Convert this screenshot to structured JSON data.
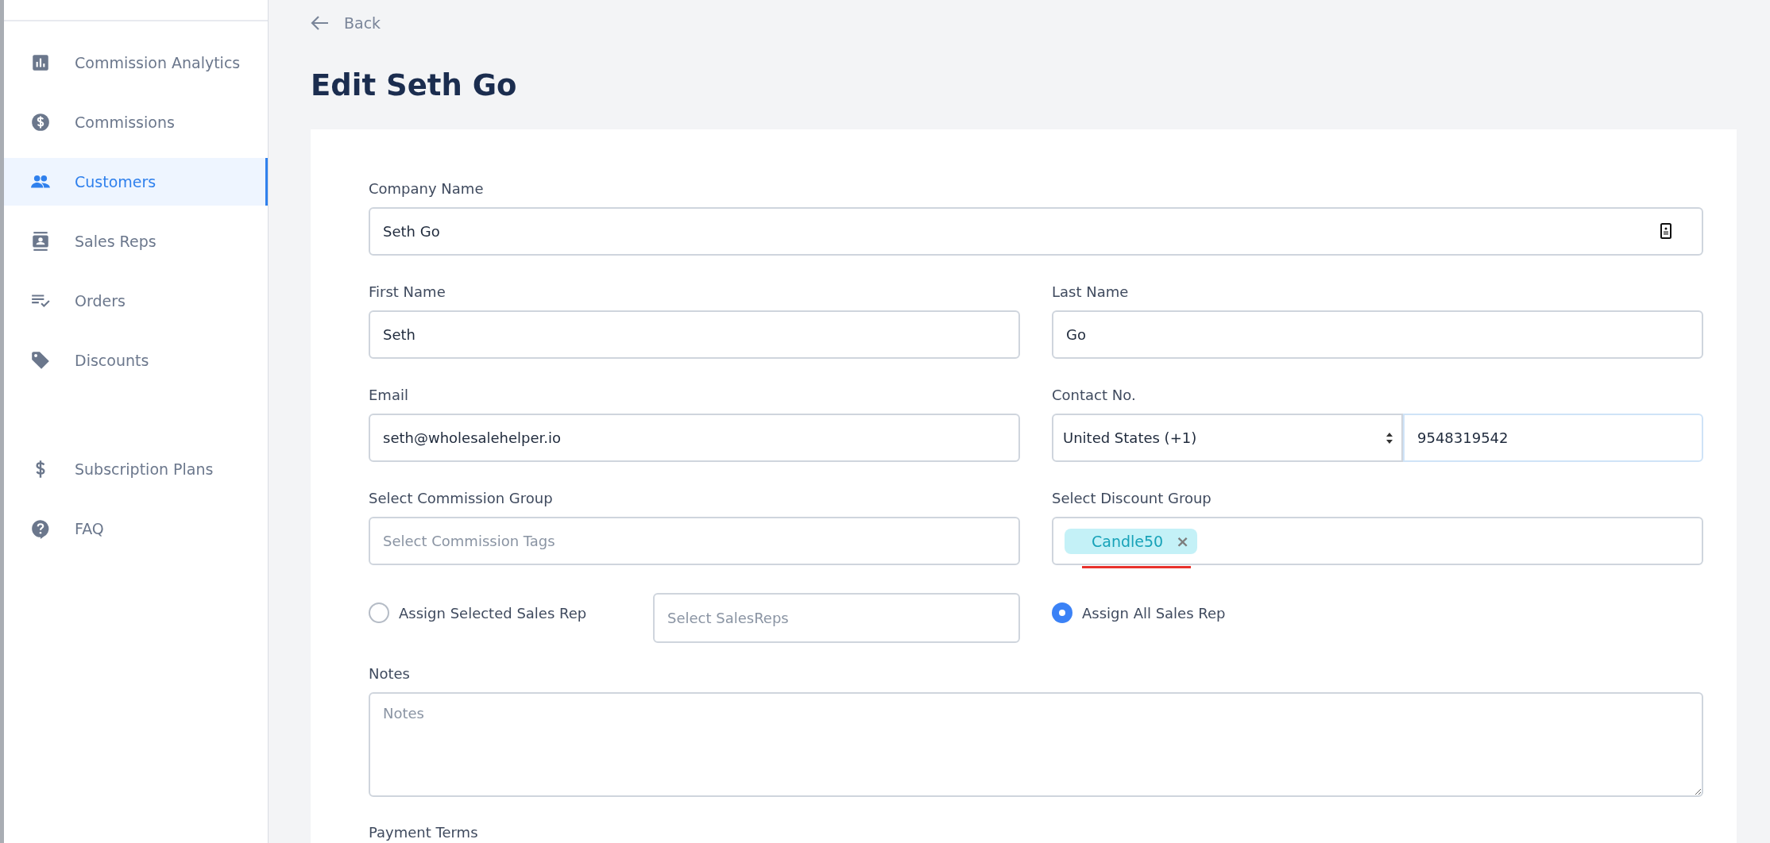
{
  "sidebar": {
    "items": [
      {
        "label": "Commission Analytics",
        "kind": "chart",
        "selected": false
      },
      {
        "label": "Commissions",
        "kind": "dollar-circle",
        "selected": false
      },
      {
        "label": "Customers",
        "kind": "people",
        "selected": true
      },
      {
        "label": "Sales Reps",
        "kind": "contact",
        "selected": false
      },
      {
        "label": "Orders",
        "kind": "list-check",
        "selected": false
      },
      {
        "label": "Discounts",
        "kind": "tag",
        "selected": false
      }
    ],
    "bottom_items": [
      {
        "label": "Subscription Plans",
        "kind": "dollar",
        "selected": false
      },
      {
        "label": "FAQ",
        "kind": "help",
        "selected": false
      }
    ]
  },
  "back_link": "Back",
  "page_title": "Edit Seth Go",
  "form": {
    "company_name": {
      "label": "Company Name",
      "value": "Seth Go"
    },
    "first_name": {
      "label": "First Name",
      "value": "Seth"
    },
    "last_name": {
      "label": "Last Name",
      "value": "Go"
    },
    "email": {
      "label": "Email",
      "value": "seth@wholesalehelper.io"
    },
    "contact": {
      "label": "Contact No.",
      "country": "United States (+1)",
      "number": "9548319542"
    },
    "commission_group": {
      "label": "Select Commission Group",
      "placeholder": "Select Commission Tags"
    },
    "discount_group": {
      "label": "Select Discount Group",
      "tags": [
        {
          "label": "Candle50",
          "remove": "×",
          "misspelled": true
        }
      ]
    },
    "assign_options": [
      {
        "label": "Assign Selected Sales Rep",
        "selected": false,
        "placeholder": "Select SalesReps"
      },
      {
        "label": "Assign All Sales Rep",
        "selected": true
      }
    ],
    "notes": {
      "label": "Notes",
      "placeholder": "Notes"
    },
    "payment_terms": {
      "label": "Payment Terms"
    }
  }
}
